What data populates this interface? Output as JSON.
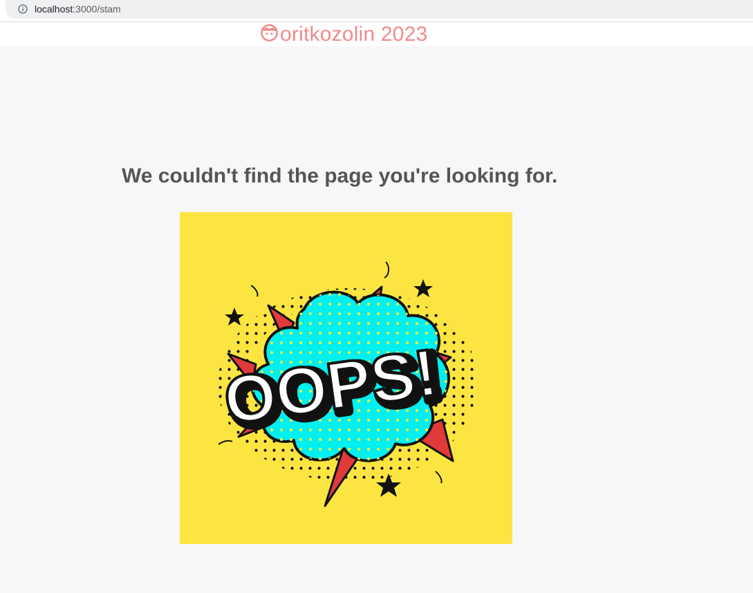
{
  "browser": {
    "url_host": "localhost",
    "url_path": ":3000/stam",
    "info_icon": "info-circle-icon"
  },
  "header": {
    "brand_icon": "face-icon",
    "brand_text": "oritkozolin 2023",
    "brand_color": "#f08a8a"
  },
  "main": {
    "heading": "We couldn't find the page you're looking for.",
    "image": {
      "name": "oops-comic-burst",
      "lettering": "OOPS!",
      "background_color": "#fde541",
      "cloud_color": "#00f0f0",
      "spike_color": "#e03a3a"
    }
  }
}
